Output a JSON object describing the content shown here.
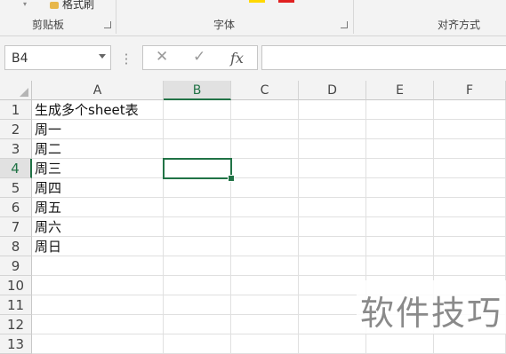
{
  "ribbon": {
    "clipboard_label": "剪贴板",
    "format_painter_label": "格式刷",
    "font_label": "字体",
    "alignment_label": "对齐方式",
    "colors": {
      "highlight": "#ffd800",
      "font_color": "#e02020"
    }
  },
  "formula_bar": {
    "name_box_value": "B4",
    "cancel_icon": "✕",
    "enter_icon": "✓",
    "fx_label": "fx",
    "formula_value": ""
  },
  "grid": {
    "columns": [
      "A",
      "B",
      "C",
      "D",
      "E",
      "F"
    ],
    "selected_column": "B",
    "rows": [
      "1",
      "2",
      "3",
      "4",
      "5",
      "6",
      "7",
      "8",
      "9",
      "10",
      "11",
      "12",
      "13"
    ],
    "selected_row": "4",
    "column_a_values": [
      "生成多个sheet表",
      "周一",
      "周二",
      "周三",
      "周四",
      "周五",
      "周六",
      "周日"
    ]
  },
  "accent_color": "#217346",
  "watermark": "软件技巧"
}
